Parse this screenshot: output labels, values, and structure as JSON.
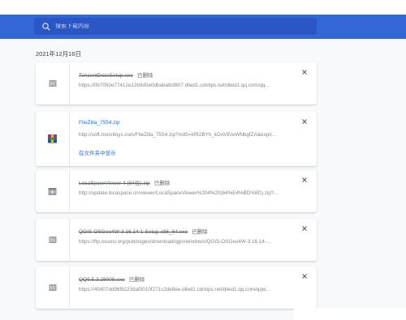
{
  "search": {
    "placeholder": "搜索下载内容"
  },
  "date_header": "2021年12月16日",
  "downloads": [
    {
      "file_name": "TencentDocsSetup.exe",
      "status": "已删除",
      "url": "https://0b7050e77412e12b9d0e0dbaba8cf807.dlied1.cdntips.net/dlied1.qq.com/qq...",
      "icon": "generic-file-icon"
    },
    {
      "file_name": "FileZilla_7554.zip",
      "status": "",
      "url": "http://soft.mocntoys.com/FileZilla_7554.zip?md5=i0R2BYh_kOAVEreWNbgfZA&expir...",
      "show_in_folder": "在文件夹中显示",
      "icon": "winrar-archive-icon"
    },
    {
      "file_name": "LocaSpaceViewer 4 (64位).zip",
      "status": "已删除",
      "url": "http://update.locaspace.cn/viewer/LocaSpaceViewer%204%20(64%E4%BD%8D).zip?...",
      "icon": "archive-icon"
    },
    {
      "file_name": "QGIS-OSGeo4W-3.16.14-1-Setup-x86_64.exe",
      "status": "已删除",
      "url": "https://ftp.osuosl.org/pub/osgeo/download/qgis/windows/QGIS-OSGeo4W-3.16.14-...",
      "icon": "generic-file-icon"
    },
    {
      "file_name": "QQ9.5.3.28008.exe",
      "status": "已删除",
      "url": "https://45407dd96f8223daf3010f271c2de8ee.dlied1.cdntips.net/dlied1.qq.com/qqw...",
      "icon": "generic-file-icon"
    }
  ],
  "colors": {
    "toolbar": "#3367d6",
    "link": "#1a73e8"
  }
}
